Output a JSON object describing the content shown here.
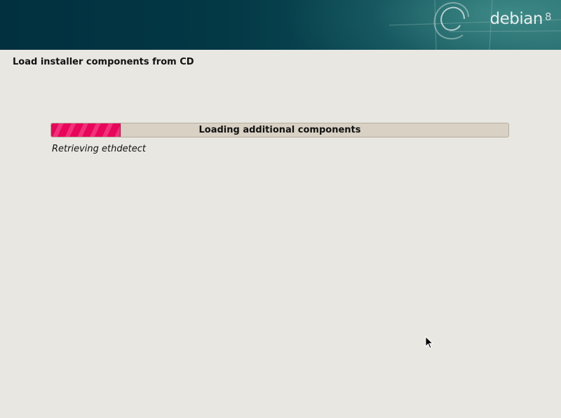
{
  "banner": {
    "brand_name": "debian",
    "brand_version": "8",
    "swirl_icon": "debian-swirl-icon"
  },
  "page": {
    "title": "Load installer components from CD"
  },
  "progress": {
    "label": "Loading additional components",
    "status": "Retrieving ethdetect",
    "percent": 15,
    "fill_color": "#e8065a"
  },
  "colors": {
    "background": "#e8e7e2",
    "banner_dark": "#02303f",
    "banner_light": "#2a6e6f",
    "accent": "#e8065a"
  },
  "cursor": {
    "icon": "mouse-pointer-icon"
  }
}
